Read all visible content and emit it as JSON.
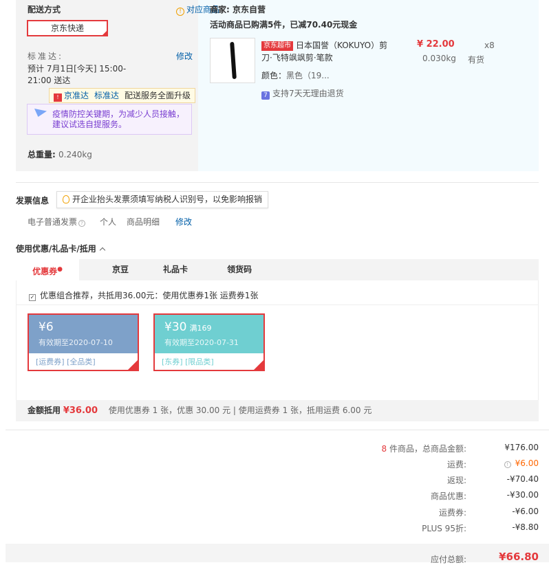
{
  "shipping": {
    "title": "配送方式",
    "std_items_link": "对应商品",
    "option": "京东快递",
    "std_label": "标准达:",
    "edit_link": "修改",
    "time_line1": "预计 7月1日[今天] 15:00-",
    "time_line2": "21:00 送达",
    "upgrade_tag": {
      "icon": "!",
      "b1": "京准达",
      "b2": "标准达",
      "text": "配送服务全面升级"
    },
    "epidemic_text": "疫情防控关键期，为减少人员接触，建议试选自提服务。",
    "weight_label": "总重量:",
    "weight_value": "0.240kg"
  },
  "product": {
    "seller": "商家: 京东自营",
    "promo": "活动商品已购满5件，已减70.40元现金",
    "badge": "京东超市",
    "name": "日本国誉（KOKUYO）剪刀·飞特飒飒剪·笔款",
    "price": "¥ 22.00",
    "qty": "x8",
    "weight": "0.030kg",
    "stock": "有货",
    "color_label": "颜色：",
    "color_value": "黑色（19...",
    "return_icon": "7",
    "return_text": "支持7天无理由退货"
  },
  "invoice": {
    "title": "发票信息",
    "tip": "开企业抬头发票须填写纳税人识别号，以免影响报销",
    "type": "电子普通发票",
    "person": "个人",
    "detail": "商品明细",
    "edit": "修改"
  },
  "coupons": {
    "title": "使用优惠/礼品卡/抵用",
    "tabs": [
      "优惠券",
      "京豆",
      "礼品卡",
      "领货码"
    ],
    "recommend": "优惠组合推荐，共抵用36.00元：使用优惠券1张 运费券1张",
    "items": [
      {
        "amount": "¥6",
        "condition": "",
        "expiry": "有效期至2020-07-10",
        "tags": "[运费券] [全品类]"
      },
      {
        "amount": "¥30",
        "condition": "满169",
        "expiry": "有效期至2020-07-31",
        "tags": "[东券] [限品类]"
      }
    ],
    "deduct_label": "金额抵用",
    "deduct_amount": "¥36.00",
    "deduct_detail": "使用优惠券 1 张，优惠 30.00 元 | 使用运费券 1 张，抵用运费 6.00 元"
  },
  "summary": {
    "count": "8",
    "count_label": "件商品，总商品金额:",
    "total_goods": "¥176.00",
    "shipping_label": "运费:",
    "shipping_value": "¥6.00",
    "rebate_label": "返现:",
    "rebate_value": "-¥70.40",
    "discount_label": "商品优惠:",
    "discount_value": "-¥30.00",
    "ship_coupon_label": "运费券:",
    "ship_coupon_value": "-¥6.00",
    "plus_label": "PLUS 95折:",
    "plus_value": "-¥8.80",
    "payable_label": "应付总额:",
    "payable_value": "¥66.80"
  }
}
